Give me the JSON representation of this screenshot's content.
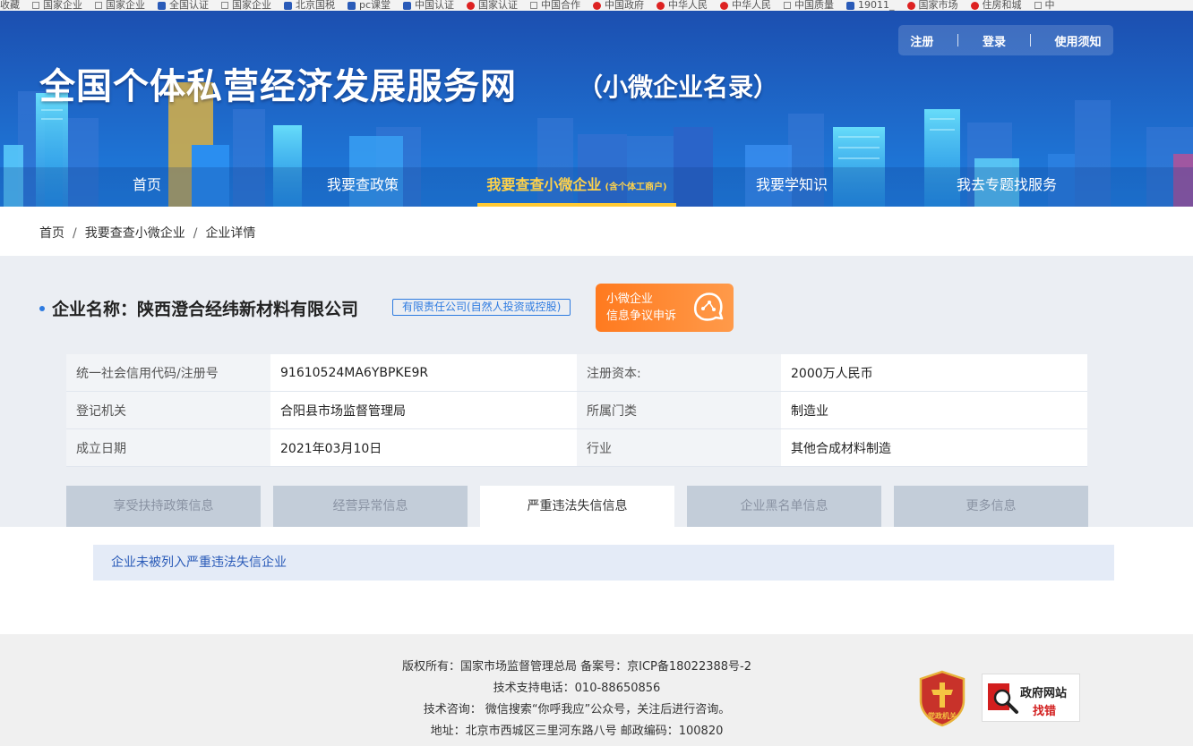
{
  "bookmarks": [
    {
      "label": "收藏",
      "icon": "none"
    },
    {
      "label": "国家企业",
      "icon": "square"
    },
    {
      "label": "国家企业",
      "icon": "square"
    },
    {
      "label": "全国认证",
      "icon": "globe"
    },
    {
      "label": "国家企业",
      "icon": "square"
    },
    {
      "label": "北京国税",
      "icon": "globe"
    },
    {
      "label": "pc课堂",
      "icon": "globe"
    },
    {
      "label": "中国认证",
      "icon": "globe"
    },
    {
      "label": "国家认证",
      "icon": "emblem"
    },
    {
      "label": "中国合作",
      "icon": "square"
    },
    {
      "label": "中国政府",
      "icon": "emblem"
    },
    {
      "label": "中华人民",
      "icon": "emblem"
    },
    {
      "label": "中华人民",
      "icon": "emblem"
    },
    {
      "label": "中国质量",
      "icon": "square"
    },
    {
      "label": "19011_",
      "icon": "globe"
    },
    {
      "label": "国家市场",
      "icon": "emblem"
    },
    {
      "label": "住房和城",
      "icon": "emblem"
    },
    {
      "label": "中",
      "icon": "square"
    }
  ],
  "header": {
    "title": "全国个体私营经济发展服务网",
    "subtitle": "（小微企业名录）",
    "links": {
      "register": "注册",
      "login": "登录",
      "guide": "使用须知"
    }
  },
  "nav": {
    "home": "首页",
    "policy": "我要查政策",
    "query": "我要查查小微企业",
    "query_note": "(含个体工商户)",
    "knowledge": "我要学知识",
    "service": "我去专题找服务"
  },
  "breadcrumb": [
    "首页",
    "我要查查小微企业",
    "企业详情"
  ],
  "company": {
    "label": "企业名称：",
    "name": "陕西澄合经纬新材料有限公司",
    "type": "有限责任公司(自然人投资或控股)",
    "dispute_line1": "小微企业",
    "dispute_line2": "信息争议申诉"
  },
  "info": [
    {
      "k1": "统一社会信用代码/注册号",
      "v1": "91610524MA6YBPKE9R",
      "k2": "注册资本:",
      "v2": "2000万人民币"
    },
    {
      "k1": "登记机关",
      "v1": "合阳县市场监督管理局",
      "k2": "所属门类",
      "v2": "制造业"
    },
    {
      "k1": "成立日期",
      "v1": "2021年03月10日",
      "k2": "行业",
      "v2": "其他合成材料制造"
    }
  ],
  "tabs": [
    "享受扶持政策信息",
    "经营异常信息",
    "严重违法失信信息",
    "企业黑名单信息",
    "更多信息"
  ],
  "active_tab": "严重违法失信信息",
  "notice": "企业未被列入严重违法失信企业",
  "footer": {
    "line1": "版权所有：国家市场监督管理总局 备案号：京ICP备18022388号-2",
    "line2": "技术支持电话：010-88650856",
    "line3": "技术咨询： 微信搜索“你呼我应”公众号，关注后进行咨询。",
    "line4": "地址：北京市西城区三里河东路八号 邮政编码：100820",
    "party_badge": "党政机关",
    "gov_badge_line1": "政府网站",
    "gov_badge_line2": "找错"
  }
}
